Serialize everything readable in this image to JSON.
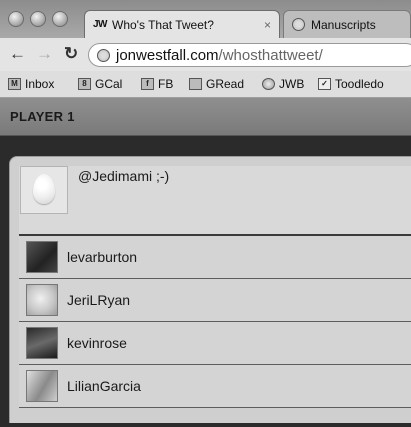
{
  "browser": {
    "tabs": [
      {
        "label": "Who's That Tweet?",
        "favicon": "JW",
        "active": true
      },
      {
        "label": "Manuscripts",
        "active": false
      }
    ],
    "tab_close": "×",
    "url": {
      "host": "jonwestfall.com",
      "path": "/whosthattweet/"
    },
    "nav": {
      "back": "←",
      "forward": "→",
      "reload": "↻"
    },
    "bookmarks": [
      {
        "label": "Inbox",
        "icon": "mail-icon"
      },
      {
        "label": "GCal",
        "icon": "calendar-icon"
      },
      {
        "label": "FB",
        "icon": "facebook-icon"
      },
      {
        "label": "GRead",
        "icon": "reader-icon"
      },
      {
        "label": "JWB",
        "icon": "globe-icon"
      },
      {
        "label": "Toodledo",
        "icon": "checkbox-icon"
      }
    ]
  },
  "game": {
    "player_label": "PLAYER 1",
    "tweet": "@Jedimami ;-)",
    "choices": [
      "levarburton",
      "JeriLRyan",
      "kevinrose",
      "LilianGarcia"
    ]
  }
}
